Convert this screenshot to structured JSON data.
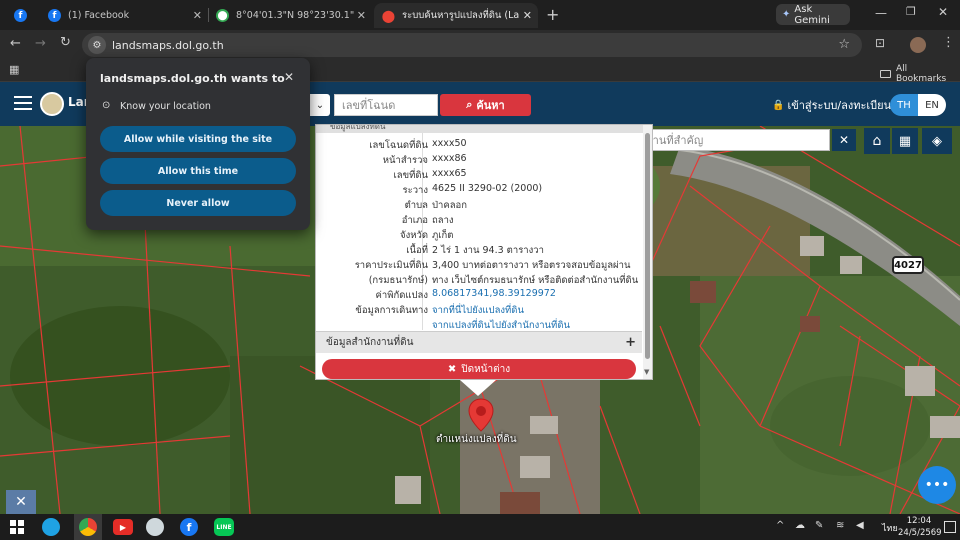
{
  "tabs": [
    {
      "label": "",
      "icon": "facebook-icon"
    },
    {
      "label": "(1) Facebook",
      "icon": "facebook-icon"
    },
    {
      "label": "8°04'01.3\"N 98°23'30.1\"E - Goo",
      "icon": "google-maps-icon"
    },
    {
      "label": "ระบบค้นหารูปแปลงที่ดิน (LandsMap",
      "icon": "location-pin-icon"
    }
  ],
  "ask_gemini": "Ask Gemini",
  "url": "landsmaps.dol.go.th",
  "bookmarks_label": "All Bookmarks",
  "permission": {
    "title": "landsmaps.dol.go.th wants to",
    "item": "Know your location",
    "allow_visit": "Allow while visiting the site",
    "allow_once": "Allow this time",
    "never": "Never allow"
  },
  "site": {
    "logo_text": "Lan",
    "search_placeholder": "เลขที่โฉนด",
    "search_button": "ค้นหา",
    "login": "เข้าสู่ระบบ/ลงทะเบียน",
    "lang_th": "TH",
    "lang_en": "EN"
  },
  "map": {
    "place_search_placeholder": "ค้นหาสถานที่สำคัญ",
    "road_number": "4027",
    "marker_label": "ตำแหน่งแปลงที่ดิน"
  },
  "info": {
    "header_partial": "ข้อมูลแปลงที่ดิน",
    "rows": [
      {
        "label": "เลขโฉนดที่ดิน",
        "value": "xxxx50",
        "link": false
      },
      {
        "label": "หน้าสำรวจ",
        "value": "xxxx86",
        "link": false
      },
      {
        "label": "เลขที่ดิน",
        "value": "xxxx65",
        "link": false
      },
      {
        "label": "ระวาง",
        "value": "4625 II 3290-02 (2000)",
        "link": false
      },
      {
        "label": "ตำบล",
        "value": "ป่าคลอก",
        "link": false
      },
      {
        "label": "อำเภอ",
        "value": "ถลาง",
        "link": false
      },
      {
        "label": "จังหวัด",
        "value": "ภูเก็ต",
        "link": false
      },
      {
        "label": "เนื้อที่",
        "value": "2 ไร่ 1 งาน 94.3 ตารางวา",
        "link": false
      },
      {
        "label": "ราคาประเมินที่ดิน",
        "value": "3,400 บาทต่อตารางวา หรือตรวจสอบข้อมูลผ่าน",
        "link": false
      },
      {
        "label": "(กรมธนารักษ์)",
        "value": "ทาง เว็บไซต์กรมธนารักษ์ หรือติดต่อสำนักงานที่ดิน",
        "link": false
      },
      {
        "label": "ค่าพิกัดแปลง",
        "value": "8.06817341,98.39129972",
        "link": true
      },
      {
        "label": "ข้อมูลการเดินทาง",
        "value": "จากที่นี่ไปยังแปลงที่ดิน",
        "link": true
      },
      {
        "label": "",
        "value": "จากแปลงที่ดินไปยังสำนักงานที่ดิน",
        "link": true
      }
    ],
    "office_section": "ข้อมูลสำนักงานที่ดิน",
    "close_button": "ปิดหน้าต่าง"
  },
  "taskbar": {
    "time": "12:04",
    "date": "24/5/2569",
    "lang": "ไทย"
  }
}
